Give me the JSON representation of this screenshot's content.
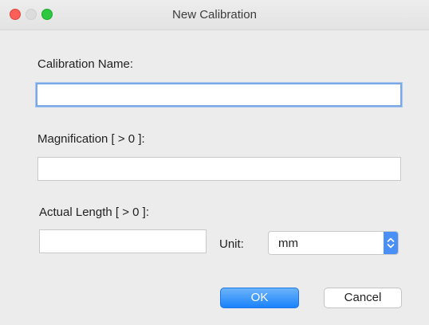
{
  "window": {
    "title": "New Calibration",
    "controls": [
      "close",
      "minimize",
      "maximize"
    ]
  },
  "form": {
    "calibration_name": {
      "label": "Calibration Name:",
      "value": ""
    },
    "magnification": {
      "label": "Magnification [ > 0 ]:",
      "value": ""
    },
    "actual_length": {
      "label": "Actual Length [ > 0 ]:",
      "value": ""
    },
    "unit": {
      "label": "Unit:",
      "selected": "mm"
    }
  },
  "buttons": {
    "ok_label": "OK",
    "cancel_label": "Cancel"
  },
  "colors": {
    "accent": "#1a82fb",
    "close": "#fc5f57",
    "maximize": "#2dc840",
    "focus_ring": "#7aa7e8"
  }
}
